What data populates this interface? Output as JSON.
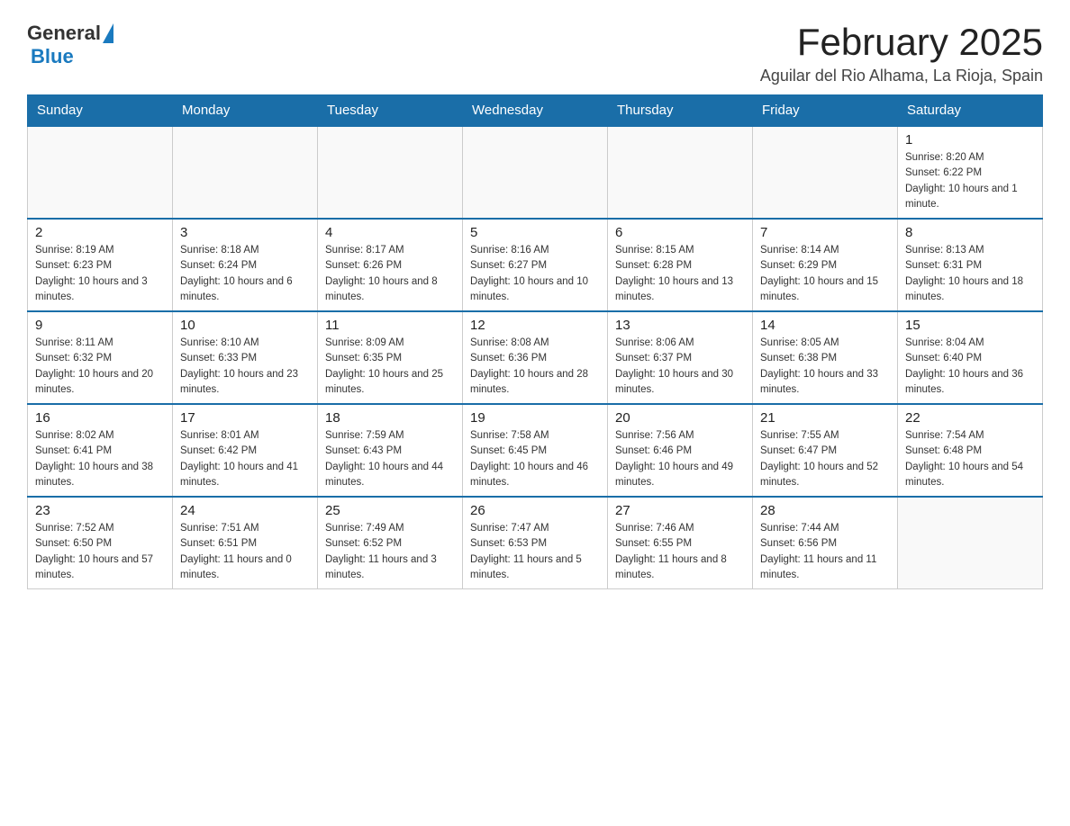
{
  "header": {
    "logo_general": "General",
    "logo_blue": "Blue",
    "title": "February 2025",
    "location": "Aguilar del Rio Alhama, La Rioja, Spain"
  },
  "days_of_week": [
    "Sunday",
    "Monday",
    "Tuesday",
    "Wednesday",
    "Thursday",
    "Friday",
    "Saturday"
  ],
  "weeks": [
    [
      {
        "day": "",
        "info": ""
      },
      {
        "day": "",
        "info": ""
      },
      {
        "day": "",
        "info": ""
      },
      {
        "day": "",
        "info": ""
      },
      {
        "day": "",
        "info": ""
      },
      {
        "day": "",
        "info": ""
      },
      {
        "day": "1",
        "info": "Sunrise: 8:20 AM\nSunset: 6:22 PM\nDaylight: 10 hours and 1 minute."
      }
    ],
    [
      {
        "day": "2",
        "info": "Sunrise: 8:19 AM\nSunset: 6:23 PM\nDaylight: 10 hours and 3 minutes."
      },
      {
        "day": "3",
        "info": "Sunrise: 8:18 AM\nSunset: 6:24 PM\nDaylight: 10 hours and 6 minutes."
      },
      {
        "day": "4",
        "info": "Sunrise: 8:17 AM\nSunset: 6:26 PM\nDaylight: 10 hours and 8 minutes."
      },
      {
        "day": "5",
        "info": "Sunrise: 8:16 AM\nSunset: 6:27 PM\nDaylight: 10 hours and 10 minutes."
      },
      {
        "day": "6",
        "info": "Sunrise: 8:15 AM\nSunset: 6:28 PM\nDaylight: 10 hours and 13 minutes."
      },
      {
        "day": "7",
        "info": "Sunrise: 8:14 AM\nSunset: 6:29 PM\nDaylight: 10 hours and 15 minutes."
      },
      {
        "day": "8",
        "info": "Sunrise: 8:13 AM\nSunset: 6:31 PM\nDaylight: 10 hours and 18 minutes."
      }
    ],
    [
      {
        "day": "9",
        "info": "Sunrise: 8:11 AM\nSunset: 6:32 PM\nDaylight: 10 hours and 20 minutes."
      },
      {
        "day": "10",
        "info": "Sunrise: 8:10 AM\nSunset: 6:33 PM\nDaylight: 10 hours and 23 minutes."
      },
      {
        "day": "11",
        "info": "Sunrise: 8:09 AM\nSunset: 6:35 PM\nDaylight: 10 hours and 25 minutes."
      },
      {
        "day": "12",
        "info": "Sunrise: 8:08 AM\nSunset: 6:36 PM\nDaylight: 10 hours and 28 minutes."
      },
      {
        "day": "13",
        "info": "Sunrise: 8:06 AM\nSunset: 6:37 PM\nDaylight: 10 hours and 30 minutes."
      },
      {
        "day": "14",
        "info": "Sunrise: 8:05 AM\nSunset: 6:38 PM\nDaylight: 10 hours and 33 minutes."
      },
      {
        "day": "15",
        "info": "Sunrise: 8:04 AM\nSunset: 6:40 PM\nDaylight: 10 hours and 36 minutes."
      }
    ],
    [
      {
        "day": "16",
        "info": "Sunrise: 8:02 AM\nSunset: 6:41 PM\nDaylight: 10 hours and 38 minutes."
      },
      {
        "day": "17",
        "info": "Sunrise: 8:01 AM\nSunset: 6:42 PM\nDaylight: 10 hours and 41 minutes."
      },
      {
        "day": "18",
        "info": "Sunrise: 7:59 AM\nSunset: 6:43 PM\nDaylight: 10 hours and 44 minutes."
      },
      {
        "day": "19",
        "info": "Sunrise: 7:58 AM\nSunset: 6:45 PM\nDaylight: 10 hours and 46 minutes."
      },
      {
        "day": "20",
        "info": "Sunrise: 7:56 AM\nSunset: 6:46 PM\nDaylight: 10 hours and 49 minutes."
      },
      {
        "day": "21",
        "info": "Sunrise: 7:55 AM\nSunset: 6:47 PM\nDaylight: 10 hours and 52 minutes."
      },
      {
        "day": "22",
        "info": "Sunrise: 7:54 AM\nSunset: 6:48 PM\nDaylight: 10 hours and 54 minutes."
      }
    ],
    [
      {
        "day": "23",
        "info": "Sunrise: 7:52 AM\nSunset: 6:50 PM\nDaylight: 10 hours and 57 minutes."
      },
      {
        "day": "24",
        "info": "Sunrise: 7:51 AM\nSunset: 6:51 PM\nDaylight: 11 hours and 0 minutes."
      },
      {
        "day": "25",
        "info": "Sunrise: 7:49 AM\nSunset: 6:52 PM\nDaylight: 11 hours and 3 minutes."
      },
      {
        "day": "26",
        "info": "Sunrise: 7:47 AM\nSunset: 6:53 PM\nDaylight: 11 hours and 5 minutes."
      },
      {
        "day": "27",
        "info": "Sunrise: 7:46 AM\nSunset: 6:55 PM\nDaylight: 11 hours and 8 minutes."
      },
      {
        "day": "28",
        "info": "Sunrise: 7:44 AM\nSunset: 6:56 PM\nDaylight: 11 hours and 11 minutes."
      },
      {
        "day": "",
        "info": ""
      }
    ]
  ]
}
